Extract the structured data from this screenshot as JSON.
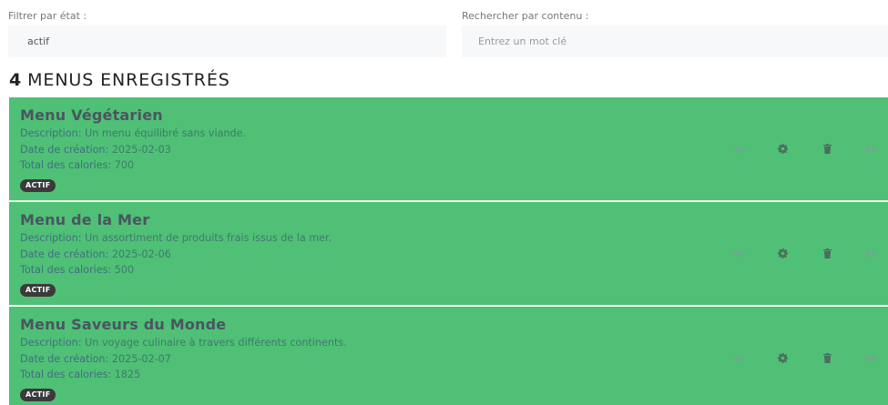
{
  "filters": {
    "state_label": "Filtrer par état :",
    "state_value": "actif",
    "search_label": "Rechercher par contenu :",
    "search_placeholder": "Entrez un mot clé"
  },
  "heading": {
    "count": "4",
    "text": "MENUS ENREGISTRÉS"
  },
  "labels": {
    "description": "Description:",
    "date": "Date de création:",
    "calories": "Total des calories:"
  },
  "menus": [
    {
      "title": "Menu Végétarien",
      "description": "Un menu équilibré sans viande.",
      "date": "2025-02-03",
      "calories": "700",
      "status": "ACTIF"
    },
    {
      "title": "Menu de la Mer",
      "description": "Un assortiment de produits frais issus de la mer.",
      "date": "2025-02-06",
      "calories": "500",
      "status": "ACTIF"
    },
    {
      "title": "Menu Saveurs du Monde",
      "description": "Un voyage culinaire à travers différents continents.",
      "date": "2025-02-07",
      "calories": "1825",
      "status": "ACTIF"
    }
  ],
  "icons": {
    "move_left": "backward-icon",
    "settings": "gear-icon",
    "delete": "trash-icon",
    "move_right": "forward-icon"
  },
  "colors": {
    "card_background": "#4fc076",
    "badge_background": "#3a3a3a"
  }
}
